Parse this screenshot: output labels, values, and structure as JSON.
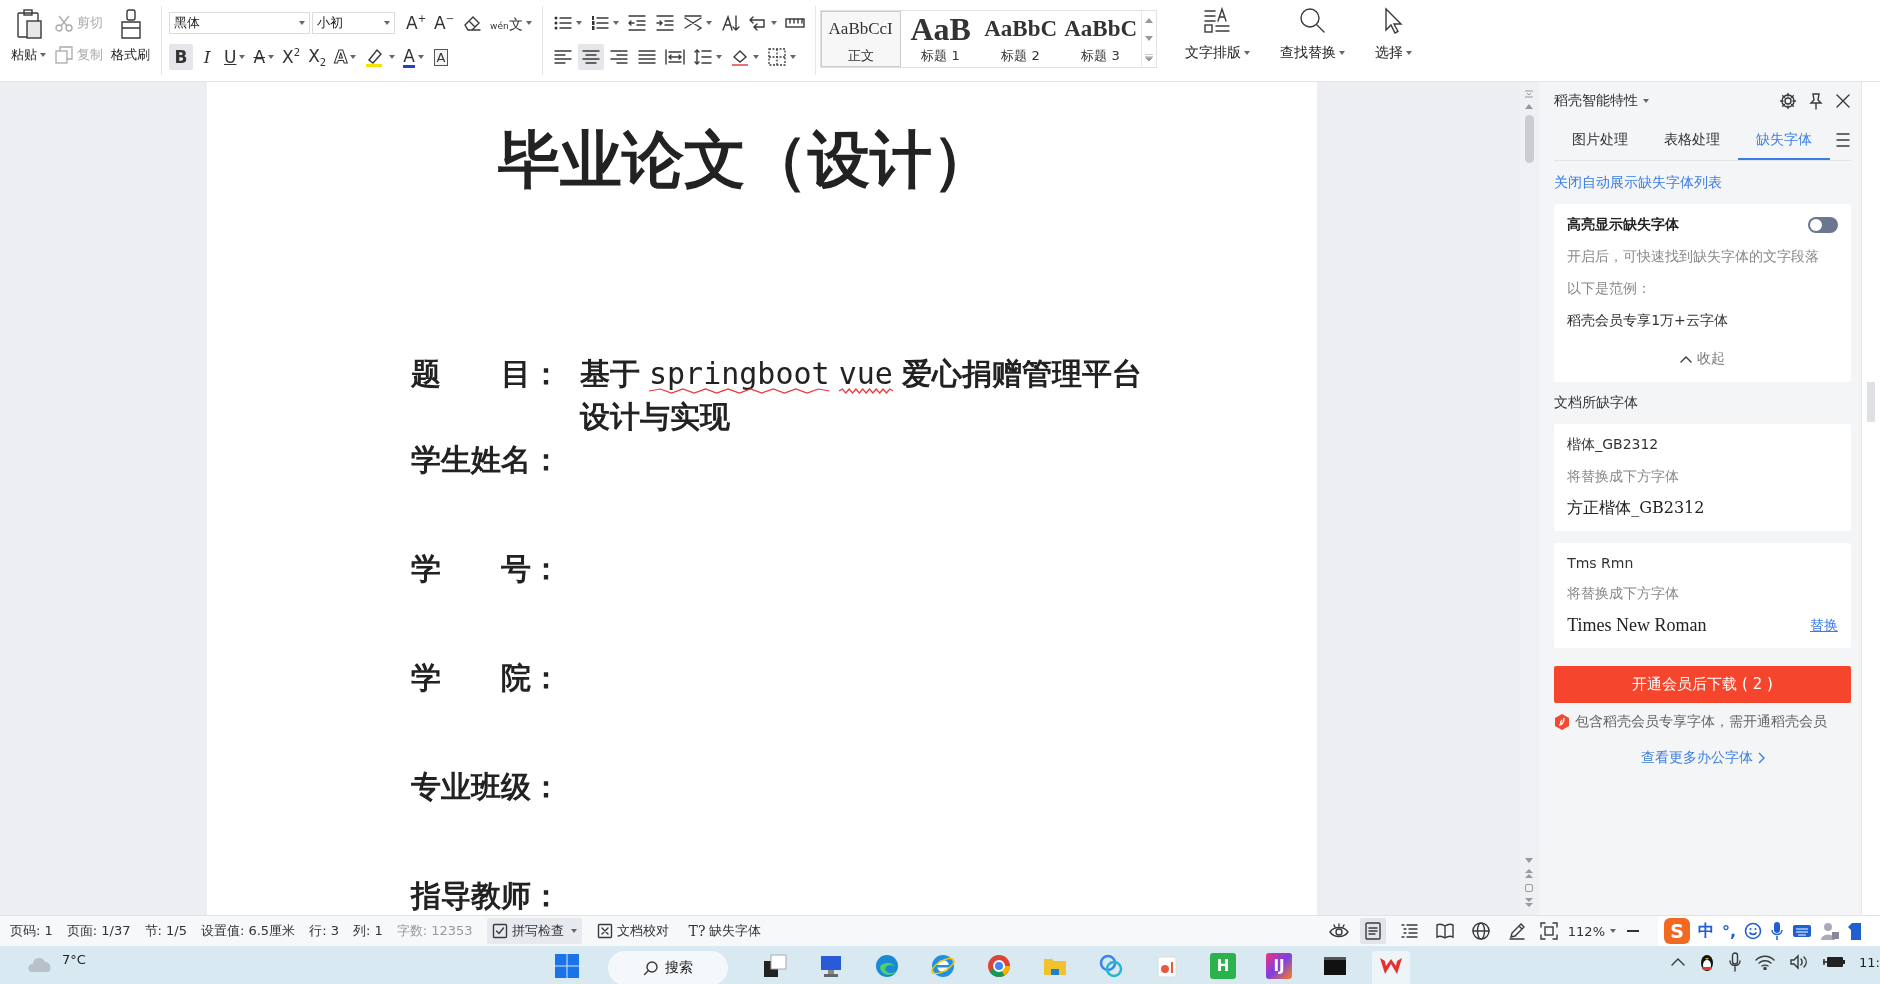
{
  "ribbon": {
    "paste": {
      "label": "粘贴",
      "dropdown": true
    },
    "cut": {
      "label": "剪切",
      "disabled": true
    },
    "copy": {
      "label": "复制",
      "disabled": true
    },
    "format_painter": {
      "label": "格式刷"
    },
    "font_name": "黑体",
    "font_size": "小初",
    "font_tools": [
      {
        "kind": "grow",
        "label": "A$^{+}$",
        "dropdown": false
      },
      {
        "kind": "shrink",
        "label": "A$^{−}$",
        "dropdown": false
      },
      {
        "kind": "eraser",
        "dropdown": false
      },
      {
        "kind": "pinyin",
        "ruby": "wén",
        "label": "文",
        "dropdown": true
      }
    ],
    "char_tools": [
      {
        "kind": "bold",
        "label": "B",
        "dropdown": false,
        "selected": true
      },
      {
        "kind": "italic",
        "label": "I",
        "dropdown": false,
        "selected": false
      },
      {
        "kind": "underline",
        "label": "U",
        "dropdown": true,
        "selected": false
      },
      {
        "kind": "strike",
        "label": "A",
        "dropdown": true,
        "selected": false
      },
      {
        "kind": "superscript",
        "label": "X$^{2}$",
        "dropdown": false,
        "selected": false
      },
      {
        "kind": "subscript",
        "label": "X$_{2}$",
        "dropdown": false,
        "selected": false
      },
      {
        "kind": "outline",
        "label": "A",
        "dropdown": true,
        "selected": false
      },
      {
        "kind": "highlighter",
        "dropdown": true,
        "selected": false
      },
      {
        "kind": "color",
        "label": "A",
        "dropdown": true,
        "selected": false
      },
      {
        "kind": "boxed",
        "label": "A",
        "dropdown": false,
        "selected": false
      }
    ],
    "paragraph_row1": [
      {
        "kind": "bullets",
        "dropdown": true
      },
      {
        "kind": "numbering",
        "dropdown": true
      },
      {
        "kind": "outdent",
        "dropdown": false
      },
      {
        "kind": "indent",
        "dropdown": false
      },
      {
        "kind": "cross-layout",
        "dropdown": true
      },
      {
        "kind": "sort",
        "dropdown": false
      },
      {
        "kind": "linebreak",
        "dropdown": true
      },
      {
        "kind": "ruler",
        "dropdown": false
      }
    ],
    "paragraph_row2": [
      {
        "kind": "align-left",
        "dropdown": false,
        "selected": false
      },
      {
        "kind": "align-center",
        "dropdown": false,
        "selected": true
      },
      {
        "kind": "align-right",
        "dropdown": false,
        "selected": false
      },
      {
        "kind": "justify",
        "dropdown": false,
        "selected": false
      },
      {
        "kind": "distribute",
        "dropdown": false,
        "selected": false
      },
      {
        "kind": "line-spacing",
        "dropdown": true,
        "selected": false
      },
      {
        "kind": "shading",
        "dropdown": true,
        "selected": false
      },
      {
        "kind": "borders",
        "dropdown": true,
        "selected": false
      }
    ],
    "styles": [
      {
        "sample": "AaBbCcI",
        "name": "正文",
        "kind": "body",
        "selected": true
      },
      {
        "sample": "AaB",
        "name": "标题 1",
        "kind": "h1",
        "selected": false
      },
      {
        "sample": "AaBbC",
        "name": "标题 2",
        "kind": "h2",
        "selected": false
      },
      {
        "sample": "AaBbC",
        "name": "标题 3",
        "kind": "h3",
        "selected": false
      }
    ],
    "big_tools": [
      {
        "kind": "text-layout",
        "label": "文字排版",
        "dropdown": true
      },
      {
        "kind": "find",
        "label": "查找替换",
        "dropdown": true
      },
      {
        "kind": "select",
        "label": "选择",
        "dropdown": true
      }
    ]
  },
  "document": {
    "title": "毕业论文（设计）",
    "fields": [
      {
        "label": "题　　目：",
        "lines": [
          [
            {
              "text": "基于",
              "misspelled": false
            },
            {
              "text": "springboot",
              "misspelled": true
            },
            {
              "text": "vue",
              "misspelled": true
            },
            {
              "text": "爱心捐赠管理平台",
              "misspelled": false
            }
          ],
          [
            {
              "text": "设计与实现",
              "misspelled": false
            }
          ]
        ]
      },
      {
        "label": "学生姓名："
      },
      {
        "label": "学　　号："
      },
      {
        "label": "学　　院："
      },
      {
        "label": "专业班级："
      },
      {
        "label": "指导教师："
      }
    ]
  },
  "panel": {
    "title": "稻壳智能特性",
    "tabs": [
      {
        "label": "图片处理",
        "selected": false
      },
      {
        "label": "表格处理",
        "selected": false
      },
      {
        "label": "缺失字体",
        "selected": true
      }
    ],
    "link": "关闭自动展示缺失字体列表",
    "highlight_card": {
      "title": "高亮显示缺失字体",
      "on": false,
      "description": "开启后，可快速找到缺失字体的文字段落",
      "example_label": "以下是范例：",
      "example": "稻壳会员专享1万+云字体",
      "collapse": "收起"
    },
    "missing_heading": "文档所缺字体",
    "missing_fonts": [
      {
        "name": "楷体_GB2312",
        "hint": "将替换成下方字体",
        "replacement": "方正楷体_GB2312",
        "kind": "kaiti"
      },
      {
        "name": "Tms Rmn",
        "hint": "将替换成下方字体",
        "replacement": "Times New Roman",
        "kind": "serif",
        "action": "替换"
      }
    ],
    "download_button": "开通会员后下载 ( 2 )",
    "notice": "包含稻壳会员专享字体，需开通稻壳会员",
    "more_link": "查看更多办公字体"
  },
  "status_bar": {
    "info": [
      {
        "text": "页码: 1",
        "dimmed": false
      },
      {
        "text": "页面: 1/37",
        "dimmed": false
      },
      {
        "text": "节: 1/5",
        "dimmed": false
      },
      {
        "text": "设置值: 6.5厘米",
        "dimmed": false
      },
      {
        "text": "行: 3",
        "dimmed": false
      },
      {
        "text": "列: 1",
        "dimmed": false
      },
      {
        "text": "字数: 12353",
        "dimmed": true
      }
    ],
    "tools": [
      {
        "kind": "spellcheck",
        "label": "拼写检查",
        "dropdown": true,
        "selected": true
      },
      {
        "kind": "proofread",
        "label": "文档校对",
        "dropdown": false,
        "selected": false
      },
      {
        "kind": "missing-font",
        "glyph": "T?",
        "label": "缺失字体",
        "dropdown": false,
        "selected": false
      }
    ],
    "views": [
      {
        "kind": "page",
        "selected": true
      },
      {
        "kind": "outline",
        "selected": false
      },
      {
        "kind": "read",
        "selected": false
      },
      {
        "kind": "web",
        "selected": false
      },
      {
        "kind": "write",
        "selected": false
      }
    ],
    "zoom": "112%"
  },
  "ime": {
    "logo": "S",
    "mode": "中",
    "punct": "°,"
  },
  "taskbar": {
    "weather": "7°C",
    "search": "搜索",
    "apps": [
      {
        "kind": "taskview",
        "active": false
      },
      {
        "kind": "remote",
        "active": false
      },
      {
        "kind": "edge",
        "active": false
      },
      {
        "kind": "ie",
        "active": false
      },
      {
        "kind": "chrome",
        "active": false
      },
      {
        "kind": "folder",
        "active": false
      },
      {
        "kind": "rings",
        "active": false
      },
      {
        "kind": "slides",
        "active": false
      },
      {
        "kind": "hbuilder",
        "label": "H",
        "active": false
      },
      {
        "kind": "idea",
        "label": "IJ",
        "active": false
      },
      {
        "kind": "terminal",
        "active": false
      },
      {
        "kind": "wps",
        "active": true
      }
    ],
    "clock": "11:"
  }
}
